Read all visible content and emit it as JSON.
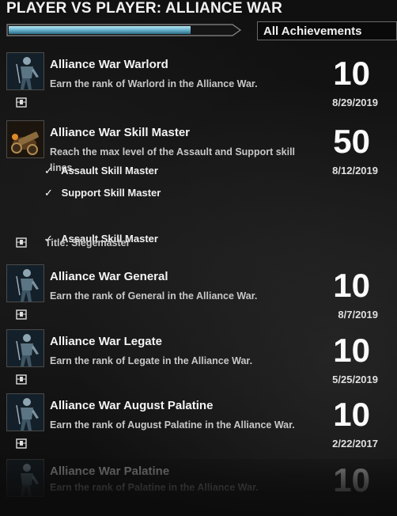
{
  "header": {
    "title": "PLAYER VS PLAYER: ALLIANCE WAR",
    "progress_fraction": 0.82,
    "filter_selected": "All Achievements"
  },
  "colors": {
    "progress_fill": "#6fb9d2",
    "text": "#f4f4f4",
    "description": "#c7c7c7"
  },
  "achievements": [
    {
      "name": "Alliance War Warlord",
      "description": "Earn the rank of Warlord in the Alliance War.",
      "points": "10",
      "date": "8/29/2019",
      "icon": "armored-soldier-icon",
      "reward_icon": "reward-chest-icon"
    },
    {
      "name": "Alliance War Skill Master",
      "description": "Reach the max level of the Assault and Support skill lines.",
      "points": "50",
      "date": "8/12/2019",
      "icon": "siege-weapon-icon",
      "criteria": [
        {
          "check": "✓",
          "label": "Assault Skill Master"
        },
        {
          "check": "✓",
          "label": "Support Skill Master"
        }
      ],
      "reward": {
        "icon": "reward-chest-icon",
        "label": "Title: Siegemaster"
      }
    },
    {
      "name": "Alliance War General",
      "description": "Earn the rank of General in the Alliance War.",
      "points": "10",
      "date": "8/7/2019",
      "icon": "armored-soldier-icon",
      "reward_icon": "reward-chest-icon"
    },
    {
      "name": "Alliance War Legate",
      "description": "Earn the rank of Legate in the Alliance War.",
      "points": "10",
      "date": "5/25/2019",
      "icon": "armored-soldier-icon",
      "reward_icon": "reward-chest-icon"
    },
    {
      "name": "Alliance War August Palatine",
      "description": "Earn the rank of August Palatine in the Alliance War.",
      "points": "10",
      "date": "2/22/2017",
      "icon": "armored-soldier-icon",
      "reward_icon": "reward-chest-icon"
    },
    {
      "name": "Alliance War Palatine",
      "description": "Earn the rank of Palatine in the Alliance War.",
      "points": "10",
      "icon": "armored-soldier-icon"
    }
  ]
}
